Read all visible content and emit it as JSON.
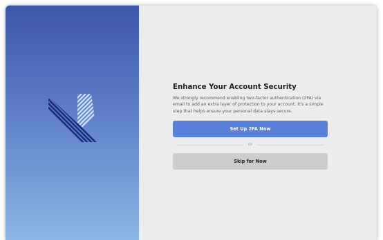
{
  "security_prompt": {
    "title": "Enhance Your Account Security",
    "description": "We strongly recommend enabling two-factor authentication (2FA) via email to add an extra layer of protection to your account. It's a simple step that helps ensure your personal data stays secure.",
    "setup_button_label": "Set Up 2FA Now",
    "divider_text": "or",
    "skip_button_label": "Skip for Now"
  },
  "colors": {
    "gradient_top": "#3d56aa",
    "gradient_bottom": "#8cb6e3",
    "primary_button": "#5980d9",
    "secondary_button": "#cdcdcd",
    "panel_background": "#ececec"
  },
  "icons": {
    "brand_logo": "striped-m-logo-icon"
  }
}
